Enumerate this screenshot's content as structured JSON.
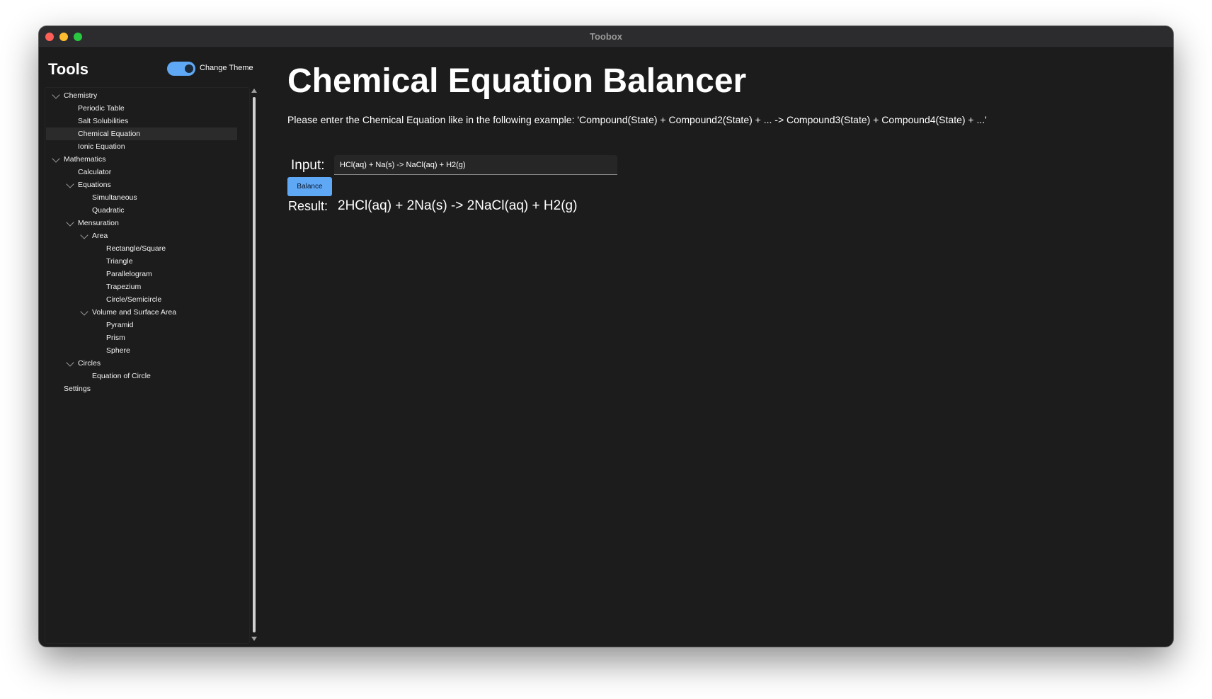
{
  "window": {
    "title": "Toobox"
  },
  "sidebar": {
    "title": "Tools",
    "theme_toggle": {
      "label": "Change Theme",
      "on": true
    },
    "tree": [
      {
        "label": "Chemistry",
        "level": 0,
        "expandable": true,
        "expanded": true
      },
      {
        "label": "Periodic Table",
        "level": 1
      },
      {
        "label": "Salt Solubilities",
        "level": 1
      },
      {
        "label": "Chemical Equation",
        "level": 1,
        "selected": true
      },
      {
        "label": "Ionic Equation",
        "level": 1
      },
      {
        "label": "Mathematics",
        "level": 0,
        "expandable": true,
        "expanded": true
      },
      {
        "label": "Calculator",
        "level": 1
      },
      {
        "label": "Equations",
        "level": 1,
        "expandable": true,
        "expanded": true
      },
      {
        "label": "Simultaneous",
        "level": 2
      },
      {
        "label": "Quadratic",
        "level": 2
      },
      {
        "label": "Mensuration",
        "level": 1,
        "expandable": true,
        "expanded": true
      },
      {
        "label": "Area",
        "level": 2,
        "expandable": true,
        "expanded": true
      },
      {
        "label": "Rectangle/Square",
        "level": 3
      },
      {
        "label": "Triangle",
        "level": 3
      },
      {
        "label": "Parallelogram",
        "level": 3
      },
      {
        "label": "Trapezium",
        "level": 3
      },
      {
        "label": "Circle/Semicircle",
        "level": 3
      },
      {
        "label": "Volume and Surface Area",
        "level": 2,
        "expandable": true,
        "expanded": true
      },
      {
        "label": "Pyramid",
        "level": 3
      },
      {
        "label": "Prism",
        "level": 3
      },
      {
        "label": "Sphere",
        "level": 3
      },
      {
        "label": "Circles",
        "level": 1,
        "expandable": true,
        "expanded": true
      },
      {
        "label": "Equation of Circle",
        "level": 2
      },
      {
        "label": "Settings",
        "level": 0
      }
    ]
  },
  "main": {
    "title": "Chemical Equation Balancer",
    "instruction": "Please enter the Chemical Equation like in the following example: 'Compound(State) + Compound2(State) + ... -> Compound3(State) + Compound4(State) + ...'",
    "input_label": "Input:",
    "input_value": "HCl(aq) + Na(s) -> NaCl(aq) + H2(g)",
    "balance_label": "Balance",
    "result_label": "Result:",
    "result_value": "2HCl(aq) + 2Na(s) -> 2NaCl(aq) + H2(g)"
  },
  "colors": {
    "accent": "#5fa8f6",
    "window_bg": "#1c1c1c",
    "titlebar_bg": "#2c2c2e",
    "selected_row": "#2b2b2b",
    "text": "#ffffff"
  }
}
